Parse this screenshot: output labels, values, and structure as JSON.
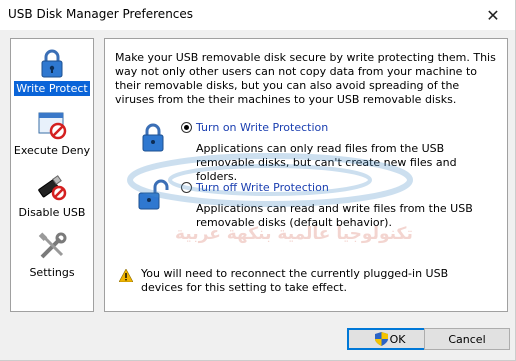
{
  "window": {
    "title": "USB Disk Manager Preferences",
    "close_icon": "close-icon"
  },
  "sidebar": {
    "items": [
      {
        "label": "Write Protect",
        "icon": "padlock-icon",
        "selected": true
      },
      {
        "label": "Execute Deny",
        "icon": "window-deny-icon",
        "selected": false
      },
      {
        "label": "Disable USB",
        "icon": "usb-disabled-icon",
        "selected": false
      },
      {
        "label": "Settings",
        "icon": "tools-icon",
        "selected": false
      }
    ]
  },
  "panel": {
    "intro": "Make your USB removable disk secure by write protecting them. This way not only other users can not copy data from your machine to their removable disks, but you can also avoid spreading of the viruses from the their machines to your USB removable disks.",
    "options": [
      {
        "title": "Turn on Write Protection",
        "description": "Applications can only read files from the USB removable disks, but can't create new files and folders.",
        "checked": true,
        "icon": "lock-closed-icon"
      },
      {
        "title": "Turn off Write Protection",
        "description": "Applications can read and write files from the USB removable disks (default behavior).",
        "checked": false,
        "icon": "lock-open-icon"
      }
    ],
    "warning": "You will need to reconnect the currently plugged-in USB devices for this setting to take effect."
  },
  "buttons": {
    "ok": "OK",
    "cancel": "Cancel"
  },
  "watermark": {
    "arabic_text": "تكنولوجيا عالمية بنكهة عربية"
  },
  "colors": {
    "selection": "#0a64d8",
    "link": "#1a3eb0",
    "warning": "#f0b400"
  }
}
